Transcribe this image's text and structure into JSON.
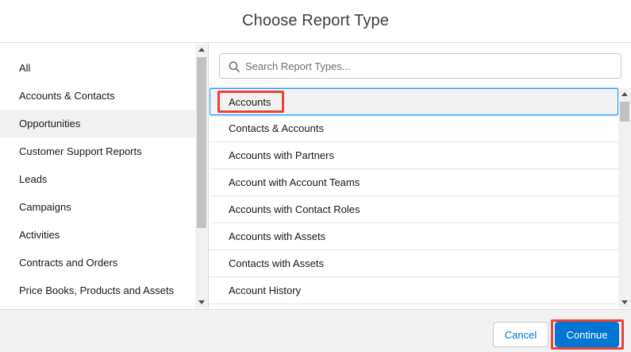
{
  "modal": {
    "title": "Choose Report Type"
  },
  "sidebar": {
    "items": [
      {
        "label": "All"
      },
      {
        "label": "Accounts & Contacts"
      },
      {
        "label": "Opportunities",
        "selected": true
      },
      {
        "label": "Customer Support Reports"
      },
      {
        "label": "Leads"
      },
      {
        "label": "Campaigns"
      },
      {
        "label": "Activities"
      },
      {
        "label": "Contracts and Orders"
      },
      {
        "label": "Price Books, Products and Assets"
      }
    ]
  },
  "search": {
    "placeholder": "Search Report Types...",
    "value": ""
  },
  "report_types": {
    "items": [
      {
        "label": "Accounts",
        "selected": true,
        "highlighted": true
      },
      {
        "label": "Contacts & Accounts"
      },
      {
        "label": "Accounts with Partners"
      },
      {
        "label": "Account with Account Teams"
      },
      {
        "label": "Accounts with Contact Roles"
      },
      {
        "label": "Accounts with Assets"
      },
      {
        "label": "Contacts with Assets"
      },
      {
        "label": "Account History"
      }
    ]
  },
  "footer": {
    "cancel_label": "Cancel",
    "continue_label": "Continue",
    "continue_highlighted": true
  },
  "colors": {
    "brand_blue": "#0176d3",
    "focus_blue": "#1b96ff",
    "highlight_red": "#e8433c",
    "selected_bg": "#f3f2f2"
  }
}
